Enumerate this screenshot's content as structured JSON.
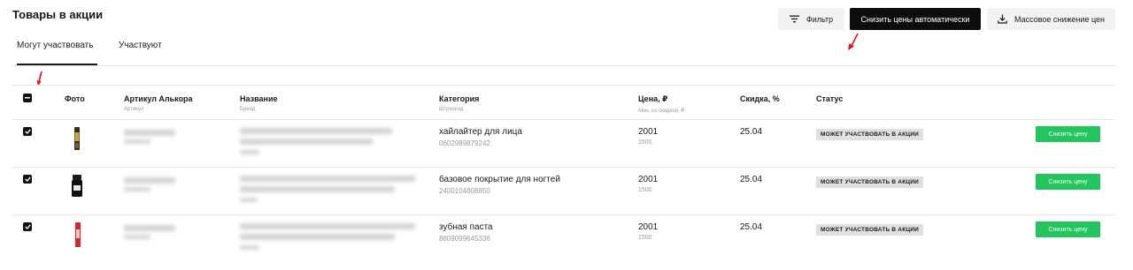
{
  "header": {
    "title": "Товары в акции"
  },
  "tabs": [
    {
      "label": "Могут участвовать",
      "active": true
    },
    {
      "label": "Участвуют",
      "active": false
    }
  ],
  "toolbar": {
    "filter_label": "Фильтр",
    "auto_reduce_label": "Снизить цены автоматически",
    "mass_reduce_label": "Массовое снижение цен"
  },
  "table": {
    "columns": {
      "photo": "Фото",
      "article": "Артикул Алькора",
      "article_sub": "Артикул",
      "name": "Название",
      "name_sub": "Бренд",
      "category": "Категория",
      "category_sub": "Штрихкод",
      "price": "Цена, ₽",
      "price_sub": "Мин. со скидкой, ₽",
      "discount": "Скидка, %",
      "status": "Статус"
    },
    "rows": [
      {
        "checked": true,
        "category": "хайлайтер для лица",
        "barcode": "0602989879242",
        "price": "2001",
        "min_price": "1500",
        "discount": "25.04",
        "status": "МОЖЕТ УЧАСТВОВАТЬ В АКЦИИ",
        "action": "Снизить цену"
      },
      {
        "checked": true,
        "category": "базовое покрытие для ногтей",
        "barcode": "2400104808850",
        "price": "2001",
        "min_price": "1500",
        "discount": "25.04",
        "status": "МОЖЕТ УЧАСТВОВАТЬ В АКЦИИ",
        "action": "Снизить цену"
      },
      {
        "checked": true,
        "category": "зубная паста",
        "barcode": "8809099645336",
        "price": "2001",
        "min_price": "1500",
        "discount": "25.04",
        "status": "МОЖЕТ УЧАСТВОВАТЬ В АКЦИИ",
        "action": "Снизить цену"
      }
    ]
  },
  "colors": {
    "accent_green": "#22c55e",
    "dark_button": "#0d0d0d",
    "annotation_red": "#e3141b"
  }
}
